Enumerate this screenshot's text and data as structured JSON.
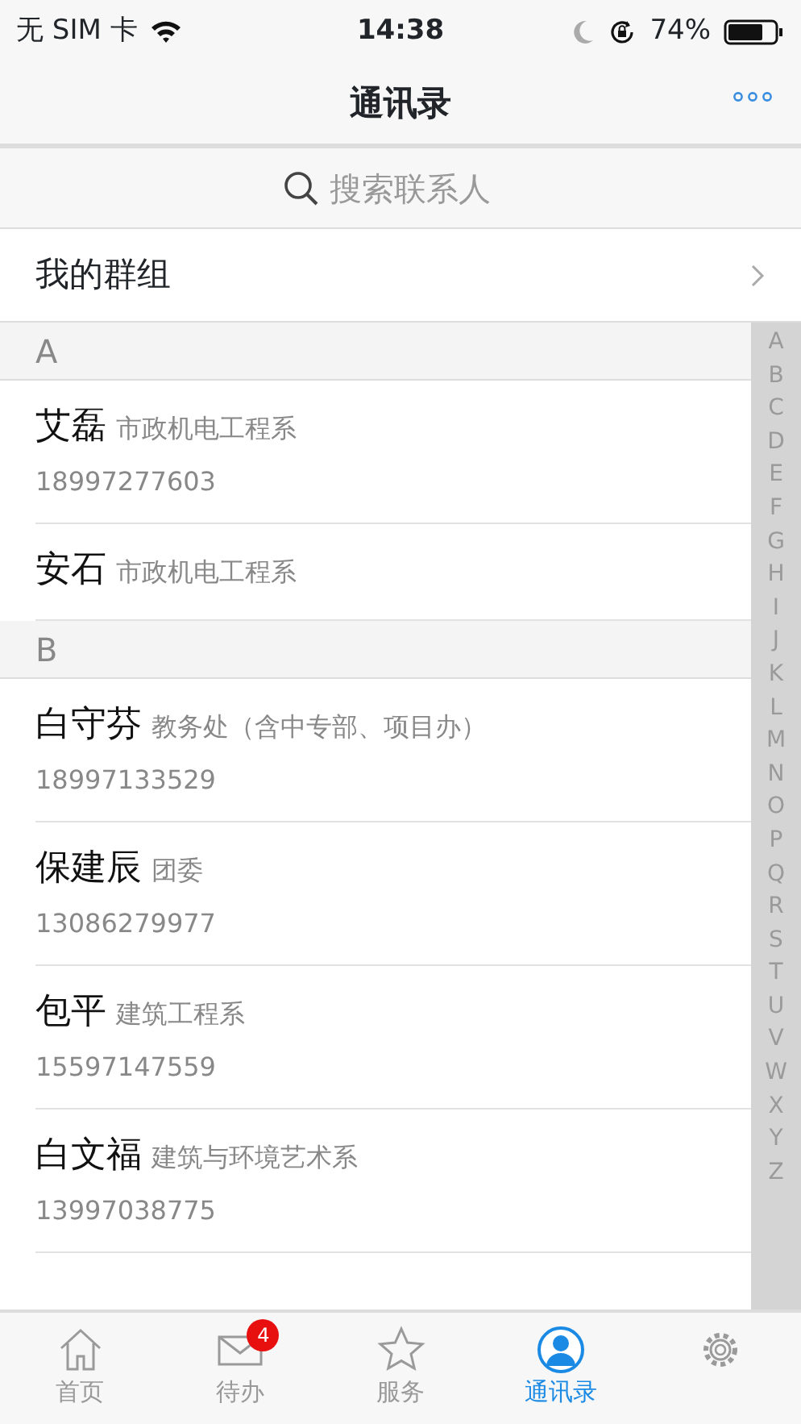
{
  "status_bar": {
    "carrier": "无 SIM 卡",
    "time": "14:38",
    "battery_text": "74%"
  },
  "nav": {
    "title": "通讯录"
  },
  "search": {
    "placeholder": "搜索联系人"
  },
  "groups_row": {
    "label": "我的群组"
  },
  "sections": [
    {
      "letter": "A",
      "contacts": [
        {
          "name": "艾磊",
          "dept": "市政机电工程系",
          "phone": "18997277603"
        },
        {
          "name": "安石",
          "dept": "市政机电工程系"
        }
      ]
    },
    {
      "letter": "B",
      "contacts": [
        {
          "name": "白守芬",
          "dept": "教务处（含中专部、项目办）",
          "phone": "18997133529"
        },
        {
          "name": "保建辰",
          "dept": "团委",
          "phone": "13086279977"
        },
        {
          "name": "包平",
          "dept": "建筑工程系",
          "phone": "15597147559"
        },
        {
          "name": "白文福",
          "dept": "建筑与环境艺术系",
          "phone": "13997038775"
        }
      ]
    }
  ],
  "index_letters": [
    "A",
    "B",
    "C",
    "D",
    "E",
    "F",
    "G",
    "H",
    "I",
    "J",
    "K",
    "L",
    "M",
    "N",
    "O",
    "P",
    "Q",
    "R",
    "S",
    "T",
    "U",
    "V",
    "W",
    "X",
    "Y",
    "Z"
  ],
  "tabs": [
    {
      "kind": "home",
      "label": "首页",
      "selected": false
    },
    {
      "kind": "mail",
      "label": "待办",
      "badge": "4",
      "selected": false
    },
    {
      "kind": "star",
      "label": "服务",
      "selected": false
    },
    {
      "kind": "person",
      "label": "通讯录",
      "selected": true
    },
    {
      "kind": "gear",
      "selected": false
    }
  ]
}
